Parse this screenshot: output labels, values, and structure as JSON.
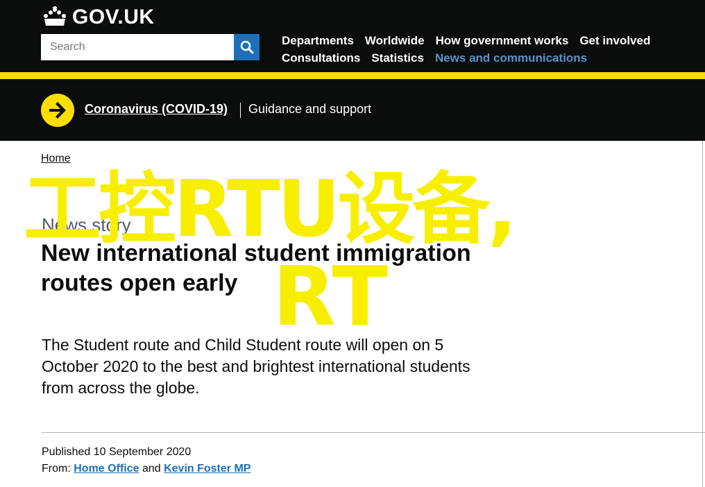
{
  "header": {
    "logo_text": "GOV.UK",
    "search_placeholder": "Search",
    "nav_row1": [
      "Departments",
      "Worldwide",
      "How government works",
      "Get involved"
    ],
    "nav_row2": [
      "Consultations",
      "Statistics",
      "News and communications"
    ],
    "active_nav": "News and communications"
  },
  "covid_banner": {
    "link_text": "Coronavirus (COVID-19)",
    "guidance_text": "Guidance and support"
  },
  "breadcrumb": {
    "home": "Home"
  },
  "article": {
    "caption": "News story",
    "title": "New international student immigration routes open early",
    "lead": "The Student route and Child Student route will open on 5 October 2020 to the best and brightest international students from across the globe.",
    "published_label": "Published",
    "published_date": "10 September 2020",
    "from_label": "From:",
    "from_org1": "Home Office",
    "from_and": "and",
    "from_org2": "Kevin Foster MP"
  },
  "watermark": {
    "line1": "工控RTU设备,",
    "line2": "RT"
  },
  "colors": {
    "header_bg": "#0b0c0c",
    "yellow": "#ffdd00",
    "link_blue": "#1d70b8",
    "active_nav_blue": "#5694ca",
    "watermark_yellow": "#f7ee00"
  },
  "icons": [
    "crown-icon",
    "search-icon",
    "arrow-right-circle-icon"
  ]
}
